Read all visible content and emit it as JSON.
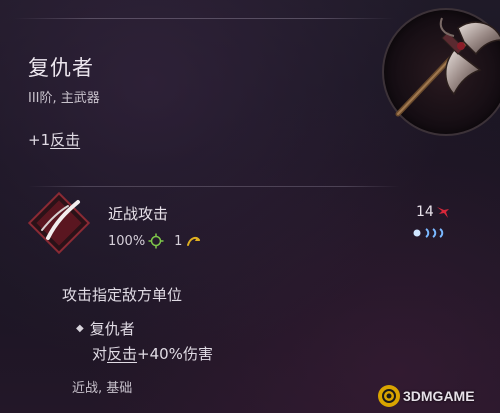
{
  "item": {
    "name": "复仇者",
    "subtitle": "III阶, 主武器",
    "bonus_prefix": "+1",
    "bonus_link": "反击"
  },
  "skill": {
    "name": "近战攻击",
    "accuracy": "100%",
    "cost": "1",
    "damage": "14",
    "description": "攻击指定敌方单位",
    "passive_name": "复仇者",
    "passive_prefix": "对",
    "passive_link": "反击",
    "passive_suffix": "+40%伤害",
    "tags": "近战, 基础"
  },
  "icons": {
    "weapon": "battle-axe-icon",
    "skill": "slash-icon",
    "accuracy": "crosshair-icon",
    "cost": "energy-curve-icon",
    "damage": "damage-burst-icon",
    "range": "range-pips-icon",
    "bullet": "diamond-bullet-icon",
    "watermark": "3dmgame-logo-icon"
  },
  "watermark": {
    "text": "3DMGAME"
  },
  "colors": {
    "accent_green": "#7ec84a",
    "accent_yellow": "#e0b020",
    "damage_red": "#d8283a",
    "range_blue": "#7ab8ff"
  }
}
